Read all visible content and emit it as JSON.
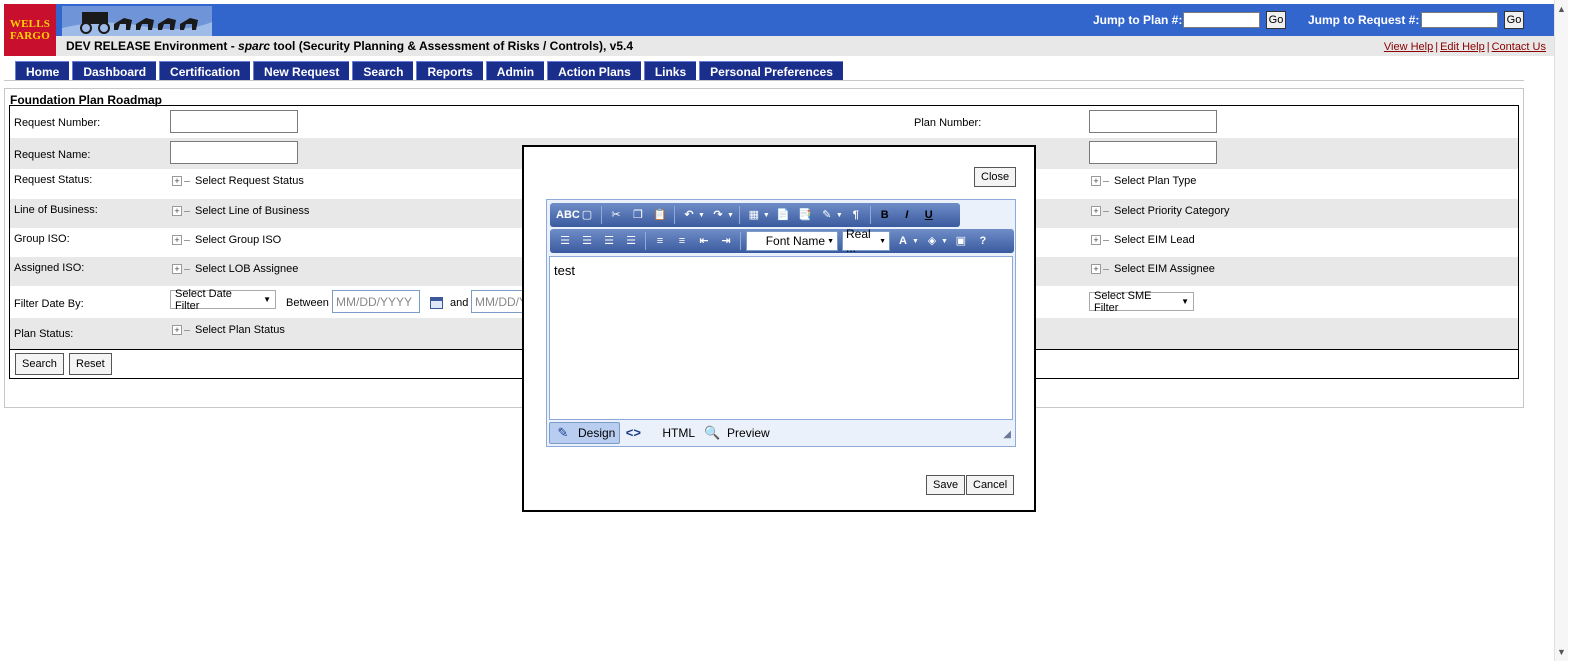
{
  "header": {
    "logo_text": "WELLS FARGO",
    "jump_plan_label": "Jump to Plan #:",
    "jump_request_label": "Jump to Request #:",
    "go_label": "Go",
    "env_prefix": "DEV RELEASE Environment - ",
    "env_tool": "sparc",
    "env_suffix": " tool (Security Planning & Assessment of Risks / Controls), v5.4",
    "help_links": [
      "View Help",
      "Edit Help",
      "Contact Us"
    ],
    "colors": {
      "banner": "#3366cc",
      "logo_bg": "#c8102e",
      "nav": "#1a2e8c"
    }
  },
  "nav": {
    "tabs": [
      "Home",
      "Dashboard",
      "Certification",
      "New Request",
      "Search",
      "Reports",
      "Admin",
      "Action Plans",
      "Links",
      "Personal Preferences"
    ]
  },
  "form": {
    "title": "Foundation Plan Roadmap",
    "request_number_label": "Request Number:",
    "plan_number_label": "Plan Number:",
    "request_name_label": "Request Name:",
    "request_status_label": "Request Status:",
    "request_status_picker": "Select Request Status",
    "plan_type_picker": "Select Plan Type",
    "lob_label": "Line of Business:",
    "lob_picker": "Select Line of Business",
    "priority_picker": "Select Priority Category",
    "group_iso_label": "Group ISO:",
    "group_iso_picker": "Select Group ISO",
    "eim_lead_picker": "Select EIM Lead",
    "assigned_iso_label": "Assigned ISO:",
    "assigned_iso_picker": "Select LOB Assignee",
    "eim_assignee_picker": "Select EIM Assignee",
    "filter_date_label": "Filter Date By:",
    "date_filter_select": "Select Date Filter",
    "between_label": "Between",
    "date_placeholder": "MM/DD/YYYY",
    "and_label": "and",
    "sme_filter_select": "Select SME Filter",
    "plan_status_label": "Plan Status:",
    "plan_status_picker": "Select Plan Status",
    "search_button": "Search",
    "reset_button": "Reset"
  },
  "modal": {
    "close_button": "Close",
    "font_name": "Font Name",
    "font_size": "Real ...",
    "content": "test",
    "mode_design": "Design",
    "mode_html": "HTML",
    "mode_preview": "Preview",
    "save_button": "Save",
    "cancel_button": "Cancel"
  }
}
